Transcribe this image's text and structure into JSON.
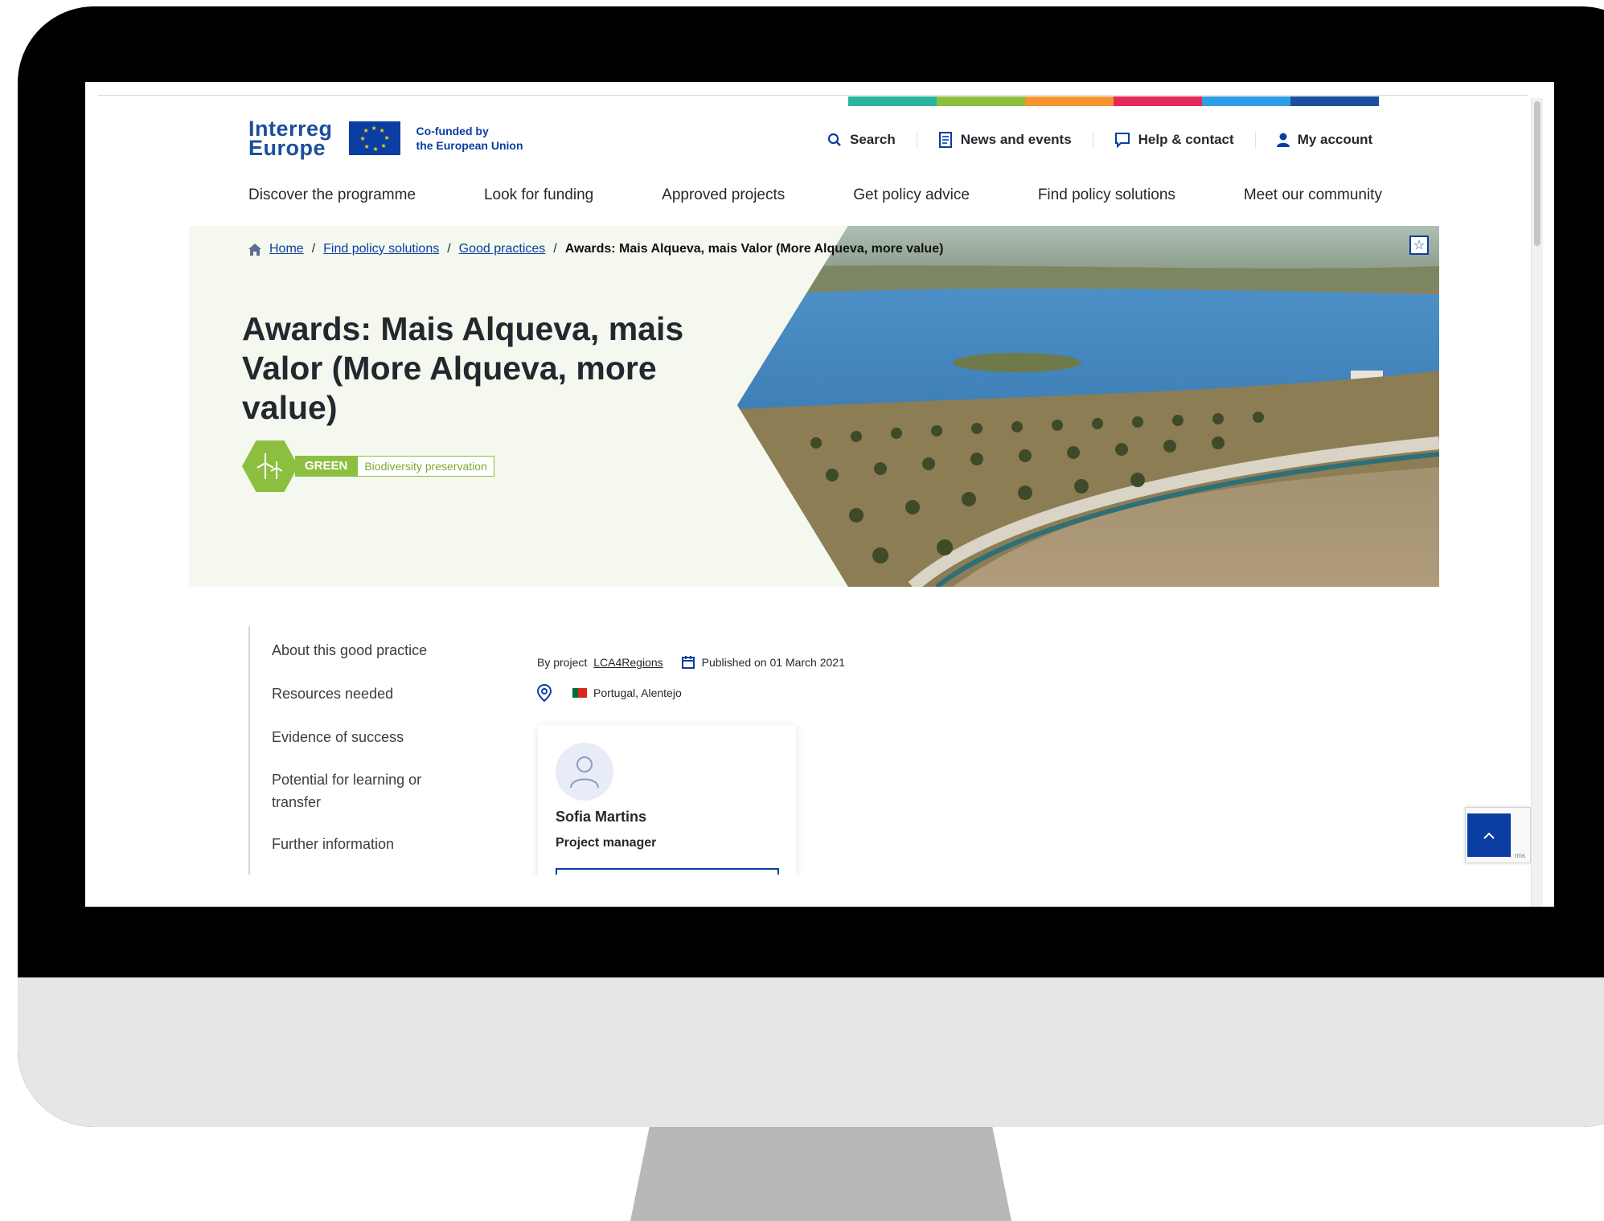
{
  "header": {
    "logo_line1": "Interreg",
    "logo_line2": "Europe",
    "cofunded_line1": "Co-funded by",
    "cofunded_line2": "the European Union",
    "stripe_colors": [
      "#2bb3a0",
      "#8cbf3f",
      "#f39431",
      "#e5285a",
      "#2f9ee4",
      "#1b4f9c"
    ],
    "utility_nav": [
      {
        "label": "Search",
        "icon": "search-icon"
      },
      {
        "label": "News and events",
        "icon": "newspaper-icon"
      },
      {
        "label": "Help & contact",
        "icon": "chat-bubble-icon"
      },
      {
        "label": "My account",
        "icon": "user-icon"
      }
    ],
    "main_nav": [
      "Discover the programme",
      "Look for funding",
      "Approved projects",
      "Get policy advice",
      "Find policy solutions",
      "Meet our community"
    ]
  },
  "breadcrumb": {
    "items": [
      "Home",
      "Find policy solutions",
      "Good practices "
    ],
    "current": "Awards: Mais Alqueva, mais Valor (More Alqueva, more value)",
    "separator": "/"
  },
  "hero": {
    "title": "Awards: Mais Alqueva, mais Valor (More Alqueva, more value)",
    "topic": "GREEN",
    "subtopic": "Biodiversity preservation",
    "topic_color": "#8cbf3f"
  },
  "side_nav": [
    "About this good practice",
    "Resources needed",
    "Evidence of success",
    "Potential for learning or transfer",
    "Further information"
  ],
  "meta": {
    "by_project": "By project",
    "project_link": "LCA4Regions",
    "published": "Published on 01 March 2021",
    "location": "Portugal, Alentejo"
  },
  "contact": {
    "name": "Sofia Martins",
    "role": "Project manager"
  },
  "colors": {
    "brand_blue": "#0a3ea2",
    "text_dark": "#24282e",
    "hero_bg": "#f4f8ef"
  }
}
